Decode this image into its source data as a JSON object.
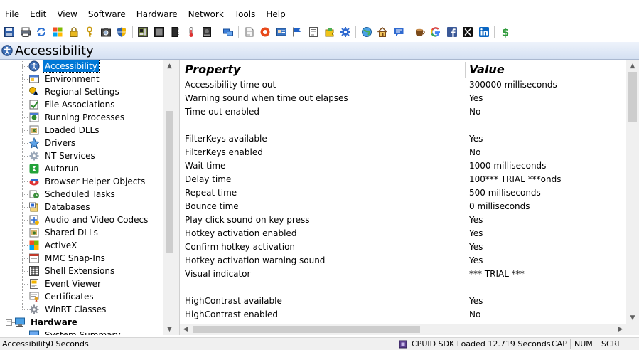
{
  "menu": [
    "File",
    "Edit",
    "View",
    "Software",
    "Hardware",
    "Network",
    "Tools",
    "Help"
  ],
  "toolbar_icons": [
    "save-icon",
    "printer-icon",
    "refresh-icon",
    "windows-logo-icon",
    "lock-icon",
    "key-icon",
    "camera-icon",
    "shield-icon",
    "motherboard-icon",
    "monitor-icon",
    "memory-icon",
    "thermometer-icon",
    "drive-icon",
    "network-icon",
    "paper-icon",
    "office-icon",
    "id-card-icon",
    "flag-icon",
    "document-icon",
    "puzzle-icon",
    "gear-icon",
    "globe-update-icon",
    "home-icon",
    "chat-icon",
    "coffee-icon",
    "google-icon",
    "facebook-icon",
    "x-icon",
    "linkedin-icon",
    "dollar-icon"
  ],
  "header": {
    "title": "Accessibility"
  },
  "tree": [
    {
      "label": "Accessibility",
      "icon": "accessibility-icon",
      "selected": true
    },
    {
      "label": "Environment",
      "icon": "environment-icon"
    },
    {
      "label": "Regional Settings",
      "icon": "regional-settings-icon"
    },
    {
      "label": "File Associations",
      "icon": "file-associations-icon"
    },
    {
      "label": "Running Processes",
      "icon": "running-processes-icon"
    },
    {
      "label": "Loaded DLLs",
      "icon": "dll-icon"
    },
    {
      "label": "Drivers",
      "icon": "drivers-icon"
    },
    {
      "label": "NT Services",
      "icon": "services-icon"
    },
    {
      "label": "Autorun",
      "icon": "autorun-icon"
    },
    {
      "label": "Browser Helper Objects",
      "icon": "bho-icon"
    },
    {
      "label": "Scheduled Tasks",
      "icon": "scheduled-tasks-icon"
    },
    {
      "label": "Databases",
      "icon": "databases-icon"
    },
    {
      "label": "Audio and Video Codecs",
      "icon": "codecs-icon"
    },
    {
      "label": "Shared DLLs",
      "icon": "shared-dll-icon"
    },
    {
      "label": "ActiveX",
      "icon": "activex-icon"
    },
    {
      "label": "MMC Snap-Ins",
      "icon": "mmc-icon"
    },
    {
      "label": "Shell Extensions",
      "icon": "shell-extensions-icon"
    },
    {
      "label": "Event Viewer",
      "icon": "event-viewer-icon"
    },
    {
      "label": "Certificates",
      "icon": "certificates-icon"
    },
    {
      "label": "WinRT Classes",
      "icon": "winrt-icon"
    }
  ],
  "tree_group": {
    "label": "Hardware",
    "child": "System Summary"
  },
  "columns": {
    "property": "Property",
    "value": "Value"
  },
  "rows": [
    {
      "p": "Accessibility time out",
      "v": "300000 milliseconds"
    },
    {
      "p": "Warning sound when time out elapses",
      "v": "Yes"
    },
    {
      "p": "Time out enabled",
      "v": "No"
    },
    {
      "p": "",
      "v": ""
    },
    {
      "p": "FilterKeys available",
      "v": "Yes"
    },
    {
      "p": "FilterKeys enabled",
      "v": "No"
    },
    {
      "p": "Wait time",
      "v": "1000 milliseconds"
    },
    {
      "p": "Delay time",
      "v": "100*** TRIAL ***onds"
    },
    {
      "p": "Repeat time",
      "v": "500 milliseconds"
    },
    {
      "p": "Bounce time",
      "v": "0 milliseconds"
    },
    {
      "p": "Play click sound on key press",
      "v": "Yes"
    },
    {
      "p": "Hotkey activation enabled",
      "v": "Yes"
    },
    {
      "p": "Confirm hotkey activation",
      "v": "Yes"
    },
    {
      "p": "Hotkey activation warning sound",
      "v": "Yes"
    },
    {
      "p": "Visual indicator",
      "v": "*** TRIAL ***"
    },
    {
      "p": "",
      "v": ""
    },
    {
      "p": "HighContrast available",
      "v": "Yes"
    },
    {
      "p": "HighContrast enabled",
      "v": "No"
    }
  ],
  "status": {
    "left": "Accessibility",
    "time": "0 Seconds",
    "sdk": "CPUID SDK Loaded 12.719 Seconds",
    "cap": "CAP",
    "num": "NUM",
    "scrl": "SCRL"
  }
}
